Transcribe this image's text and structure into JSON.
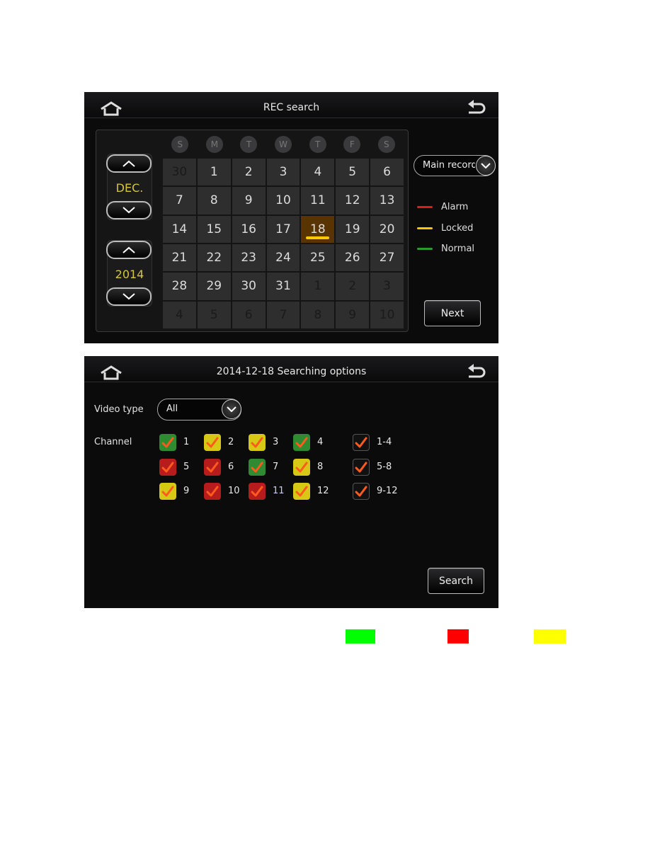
{
  "screen1": {
    "title": "REC search",
    "month": "DEC.",
    "year": "2014",
    "weekdays": [
      "S",
      "M",
      "T",
      "W",
      "T",
      "F",
      "S"
    ],
    "days": [
      {
        "n": "30",
        "dim": true
      },
      {
        "n": "1"
      },
      {
        "n": "2"
      },
      {
        "n": "3"
      },
      {
        "n": "4"
      },
      {
        "n": "5"
      },
      {
        "n": "6"
      },
      {
        "n": "7"
      },
      {
        "n": "8"
      },
      {
        "n": "9"
      },
      {
        "n": "10"
      },
      {
        "n": "11"
      },
      {
        "n": "12"
      },
      {
        "n": "13"
      },
      {
        "n": "14"
      },
      {
        "n": "15"
      },
      {
        "n": "16"
      },
      {
        "n": "17"
      },
      {
        "n": "18",
        "selected": true
      },
      {
        "n": "19"
      },
      {
        "n": "20"
      },
      {
        "n": "21"
      },
      {
        "n": "22"
      },
      {
        "n": "23"
      },
      {
        "n": "24"
      },
      {
        "n": "25"
      },
      {
        "n": "26"
      },
      {
        "n": "27"
      },
      {
        "n": "28"
      },
      {
        "n": "29"
      },
      {
        "n": "30"
      },
      {
        "n": "31"
      },
      {
        "n": "1",
        "dim": true
      },
      {
        "n": "2",
        "dim": true
      },
      {
        "n": "3",
        "dim": true
      },
      {
        "n": "4",
        "dim": true
      },
      {
        "n": "5",
        "dim": true
      },
      {
        "n": "6",
        "dim": true
      },
      {
        "n": "7",
        "dim": true
      },
      {
        "n": "8",
        "dim": true
      },
      {
        "n": "9",
        "dim": true
      },
      {
        "n": "10",
        "dim": true
      }
    ],
    "stream_select": "Main record",
    "legend": [
      {
        "label": "Alarm",
        "color": "#e01b1b"
      },
      {
        "label": "Locked",
        "color": "#ffc400"
      },
      {
        "label": "Normal",
        "color": "#2a9a2a"
      }
    ],
    "next_label": "Next"
  },
  "screen2": {
    "title": "2014-12-18  Searching options",
    "video_type_label": "Video type",
    "video_type_value": "All",
    "channel_label": "Channel",
    "channels": [
      {
        "label": "1",
        "color": "green"
      },
      {
        "label": "2",
        "color": "yellow"
      },
      {
        "label": "3",
        "color": "yellow"
      },
      {
        "label": "4",
        "color": "green"
      },
      {
        "label": "5",
        "color": "red"
      },
      {
        "label": "6",
        "color": "red"
      },
      {
        "label": "7",
        "color": "green"
      },
      {
        "label": "8",
        "color": "yellow"
      },
      {
        "label": "9",
        "color": "yellow"
      },
      {
        "label": "10",
        "color": "red"
      },
      {
        "label": "11",
        "color": "red"
      },
      {
        "label": "12",
        "color": "yellow"
      }
    ],
    "groups": [
      {
        "label": "1-4"
      },
      {
        "label": "5-8"
      },
      {
        "label": "9-12"
      }
    ],
    "search_label": "Search"
  },
  "swatches": [
    "#00ff00",
    "#ff0000",
    "#ffff00"
  ]
}
